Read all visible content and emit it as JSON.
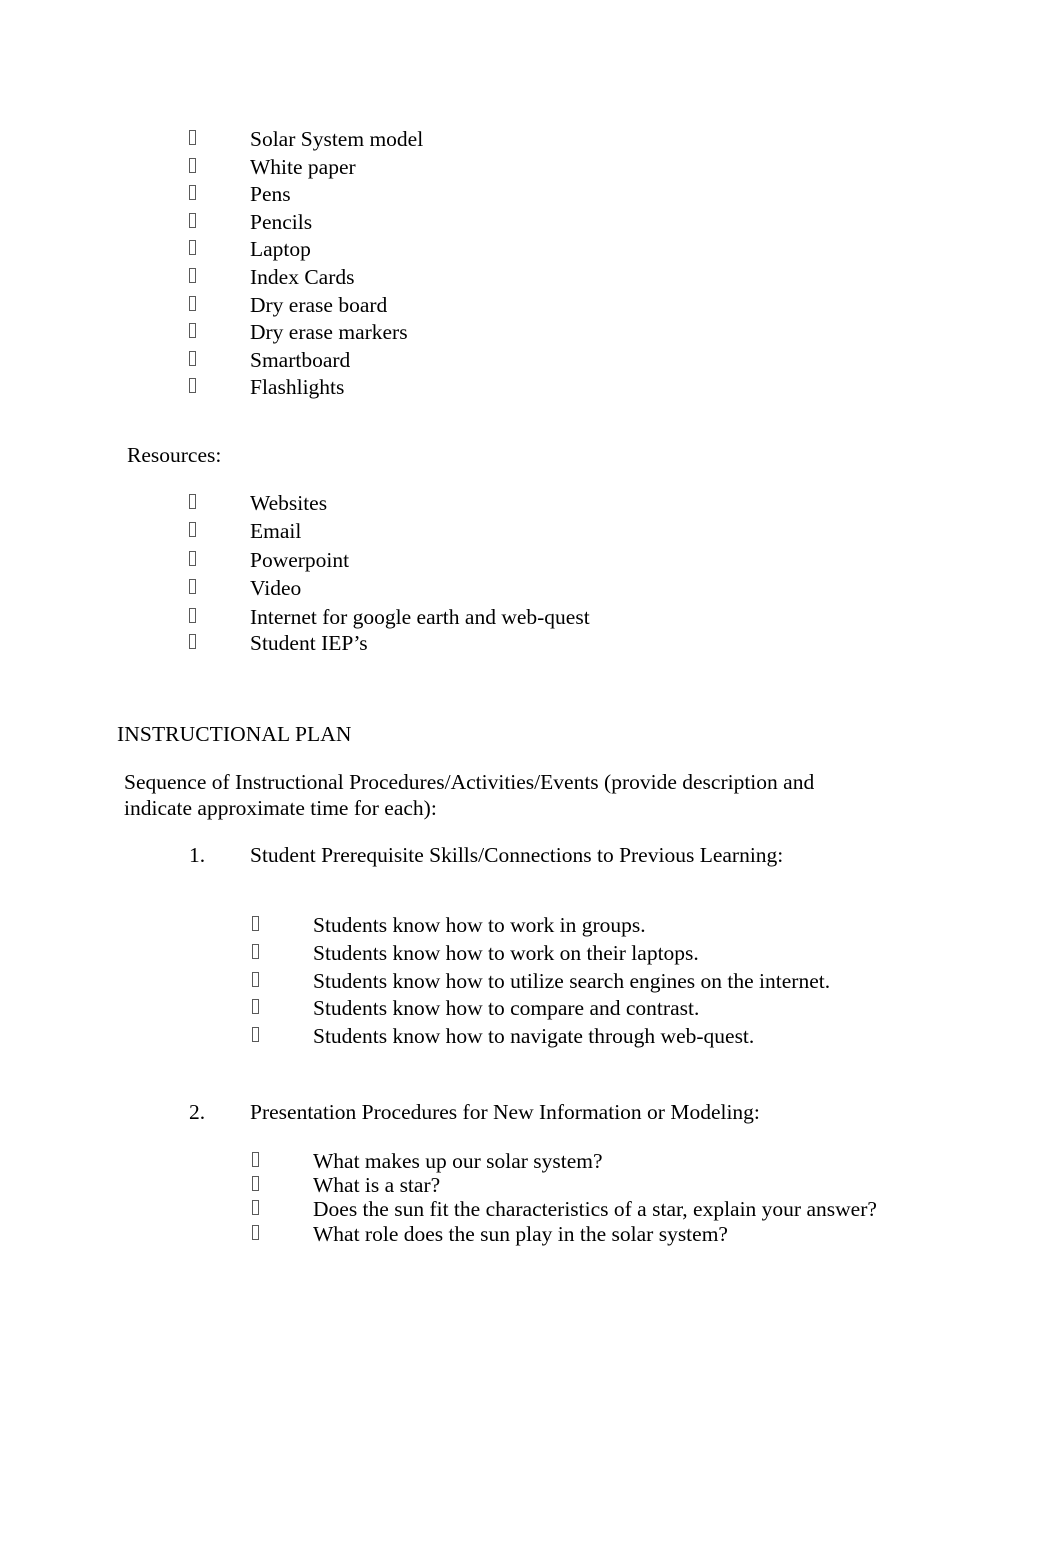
{
  "document": {
    "bullet_glyph": "missing-glyph-box",
    "text_color": "#000000",
    "page_background": "#ffffff"
  },
  "materials": {
    "items": [
      {
        "text": "Solar System model"
      },
      {
        "text": "White paper"
      },
      {
        "text": "Pens"
      },
      {
        "text": "Pencils"
      },
      {
        "text": "Laptop"
      },
      {
        "text": "Index Cards"
      },
      {
        "text": "Dry erase board"
      },
      {
        "text": "Dry erase markers"
      },
      {
        "text": "Smartboard"
      },
      {
        "text": "Flashlights"
      }
    ]
  },
  "resources": {
    "label": "Resources:",
    "items": [
      {
        "text": "Websites"
      },
      {
        "text": "Email"
      },
      {
        "text": "Powerpoint"
      },
      {
        "text": "Video"
      },
      {
        "text": "Internet for google earth and web-quest"
      },
      {
        "text": "Student IEP’s"
      }
    ]
  },
  "instructional_plan": {
    "heading": "INSTRUCTIONAL PLAN",
    "sequence_paragraph": "Sequence of Instructional Procedures/Activities/Events (provide description and indicate approximate time for each):",
    "steps": [
      {
        "number": "1.",
        "title": "Student Prerequisite Skills/Connections to Previous Learning:",
        "items": [
          {
            "text": "Students know how to work in groups."
          },
          {
            "text": "Students know how to work on their laptops."
          },
          {
            "text": "Students know how to utilize search engines on the internet."
          },
          {
            "text": "Students know how to compare and contrast."
          },
          {
            "text": "Students know how to navigate through web-quest."
          }
        ]
      },
      {
        "number": "2.",
        "title": "Presentation Procedures for New Information or Modeling:",
        "items": [
          {
            "text": "What makes up our solar system?"
          },
          {
            "text": "What is a star?"
          },
          {
            "text": "Does the sun fit the characteristics of a star, explain your answer?"
          },
          {
            "text": "What role does the sun play in the solar system?"
          }
        ]
      }
    ]
  }
}
